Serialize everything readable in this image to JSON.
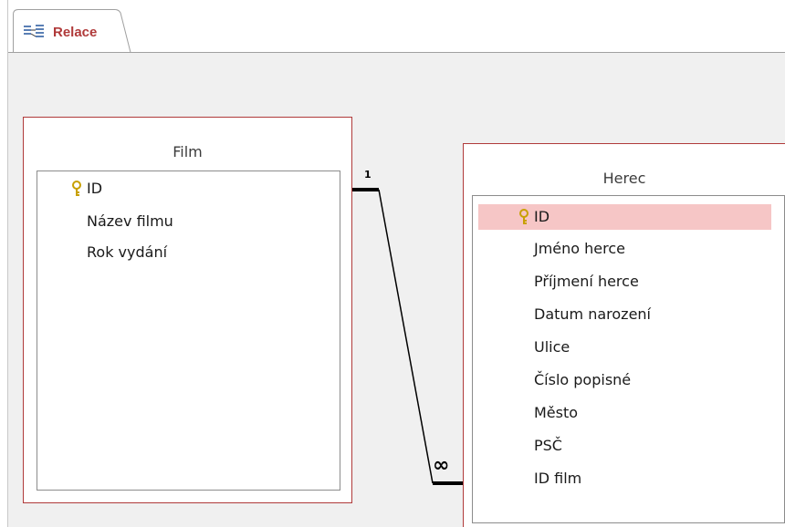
{
  "tab": {
    "label": "Relace",
    "icon": "relationships-icon"
  },
  "tables": {
    "film": {
      "title": "Film",
      "fields": [
        {
          "name": "ID",
          "primary_key": true
        },
        {
          "name": "Název filmu"
        },
        {
          "name": "Rok vydání"
        }
      ]
    },
    "herec": {
      "title": "Herec",
      "fields": [
        {
          "name": "ID",
          "primary_key": true,
          "selected": true
        },
        {
          "name": "Jméno herce"
        },
        {
          "name": "Příjmení herce"
        },
        {
          "name": "Datum narození"
        },
        {
          "name": "Ulice"
        },
        {
          "name": "Číslo popisné"
        },
        {
          "name": "Město"
        },
        {
          "name": "PSČ"
        },
        {
          "name": "ID film"
        }
      ]
    }
  },
  "relationship": {
    "one_side_label": "1",
    "many_side_label": "∞"
  },
  "colors": {
    "accent": "#b03a3a",
    "selected_row": "#f6c6c6",
    "canvas": "#f0f0f0",
    "key_icon": "#c8a000"
  }
}
